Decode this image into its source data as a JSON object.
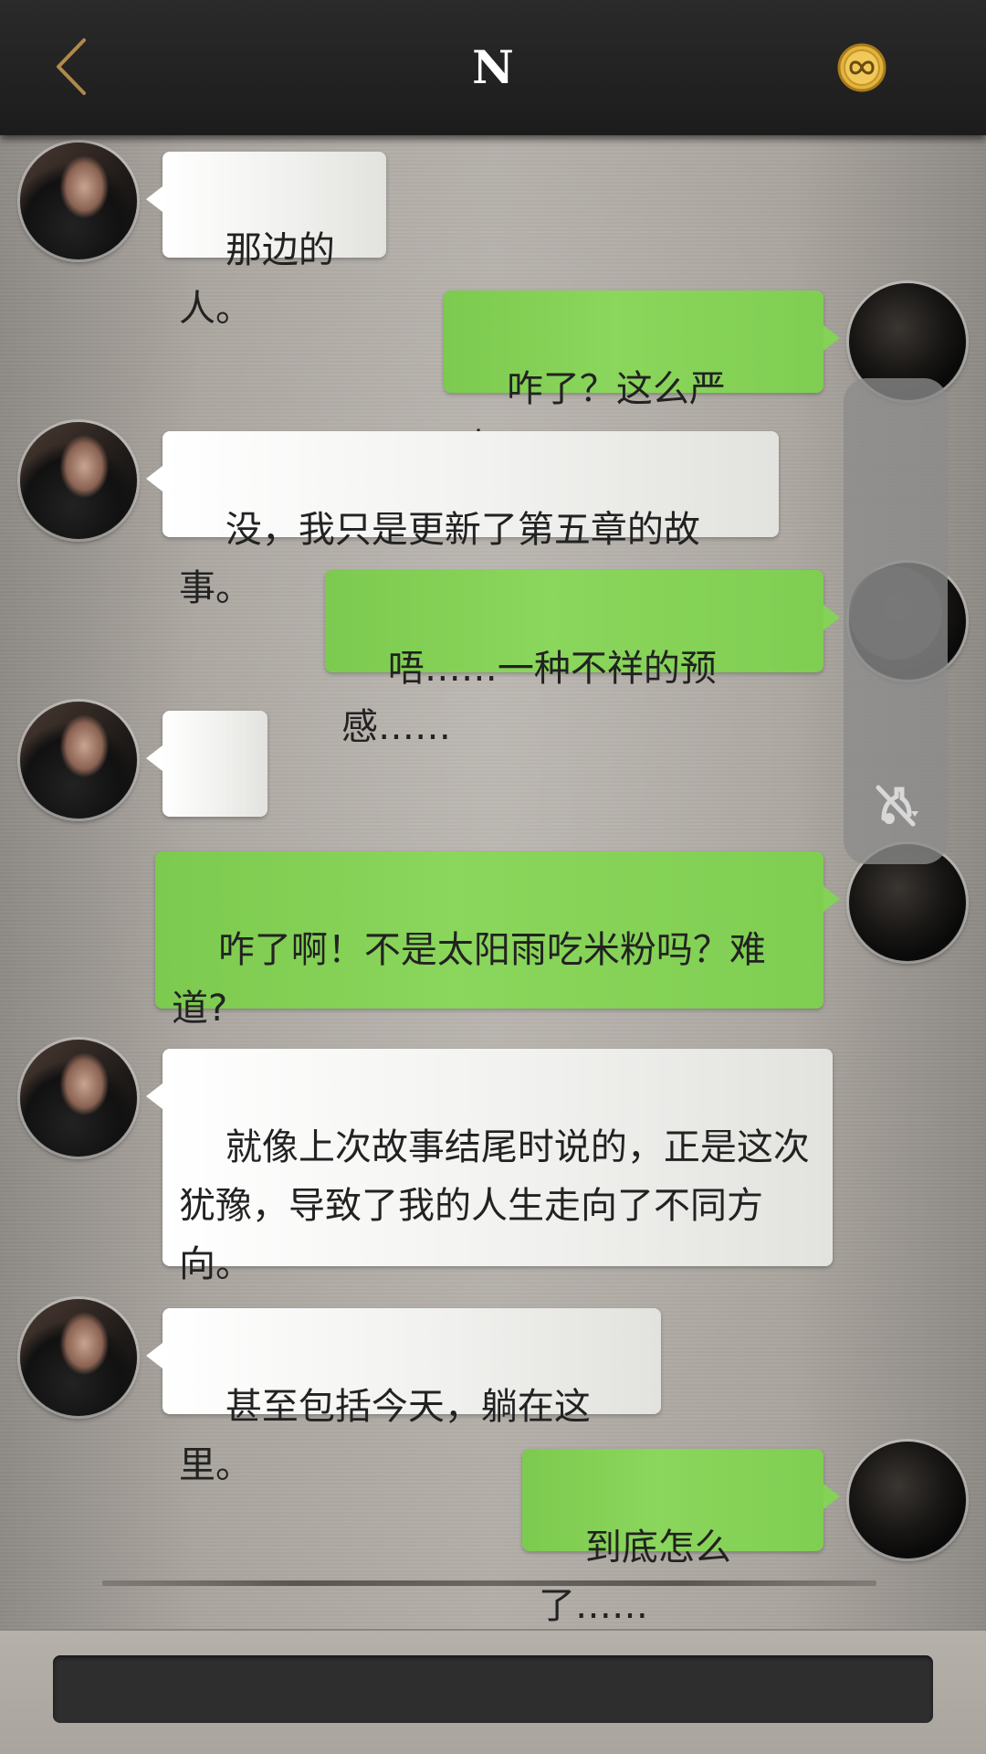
{
  "header": {
    "title": "N",
    "back_icon": "chevron-left-icon",
    "coin_icon": "infinity-coin-icon",
    "accent_color": "#b08a4a"
  },
  "messages": [
    {
      "sender": "contact",
      "text": "那边的人。"
    },
    {
      "sender": "me",
      "text": "咋了？这么严肃……"
    },
    {
      "sender": "contact",
      "text": "没，我只是更新了第五章的故事。"
    },
    {
      "sender": "me",
      "text": "唔……一种不祥的预感……"
    },
    {
      "sender": "contact",
      "text": "……"
    },
    {
      "sender": "me",
      "text": "咋了啊！不是太阳雨吃米粉吗？难\n道?"
    },
    {
      "sender": "contact",
      "text": "就像上次故事结尾时说的，正是这次\n犹豫，导致了我的人生走向了不同方\n向。"
    },
    {
      "sender": "contact",
      "text": "甚至包括今天，躺在这里。"
    },
    {
      "sender": "me",
      "text": "到底怎么了……"
    }
  ],
  "floating_panel": {
    "icon": "mute-assistant-icon"
  },
  "colors": {
    "header_bg": "#1f1f1f",
    "incoming_bubble": "#f1f1ef",
    "outgoing_bubble": "#84d257",
    "input_bg": "#2e2e2e"
  }
}
